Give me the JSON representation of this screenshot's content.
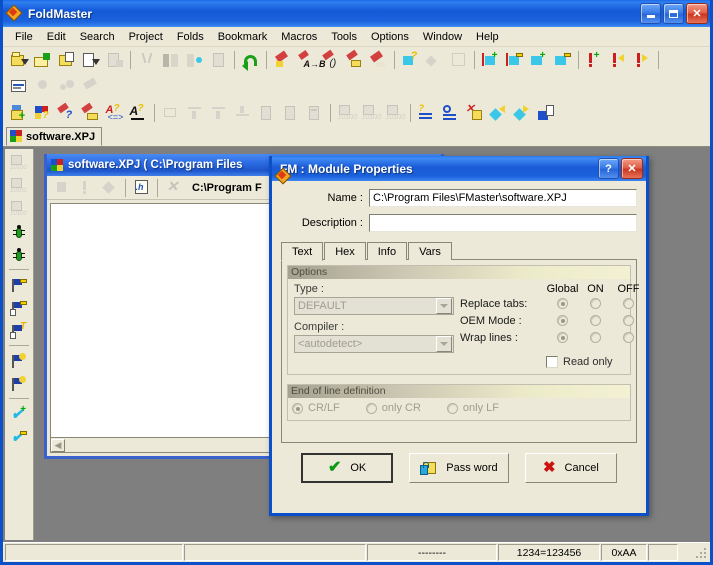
{
  "app": {
    "title": "FoldMaster",
    "icon": "diamond-icon",
    "caption_buttons": {
      "minimize": "minimize-button",
      "maximize": "maximize-button",
      "close": "close-button"
    }
  },
  "menubar": {
    "items": [
      "File",
      "Edit",
      "Search",
      "Project",
      "Folds",
      "Bookmark",
      "Macros",
      "Tools",
      "Options",
      "Window",
      "Help"
    ]
  },
  "project_tabs": [
    {
      "label": "software.XPJ",
      "icon": "project-icon",
      "active": true
    }
  ],
  "mdi_child": {
    "title": "software.XPJ ( C:\\Program Files",
    "path": "C:\\Program F",
    "toolbar": [
      "lock-icon",
      "exclamation-icon",
      "diamond-small-icon",
      "header-file-icon",
      "close-x-icon"
    ]
  },
  "dialog": {
    "title": "FM : Module Properties",
    "icon": "diamond-icon",
    "help_button": "?",
    "close_button": "✕",
    "fields": [
      {
        "label": "Name :",
        "value": "C:\\Program Files\\FMaster\\software.XPJ",
        "placeholder": ""
      },
      {
        "label": "Description :",
        "value": "",
        "placeholder": ""
      }
    ],
    "tabs": [
      {
        "label": "Text",
        "active": true
      },
      {
        "label": "Hex",
        "active": false
      },
      {
        "label": "Info",
        "active": false
      },
      {
        "label": "Vars",
        "active": false
      }
    ],
    "options_group": {
      "title": "Options",
      "type_label": "Type :",
      "type_value": "DEFAULT",
      "compiler_label": "Compiler :",
      "compiler_value": "<autodetect>",
      "columns": [
        "Global",
        "ON",
        "OFF"
      ],
      "rows": [
        {
          "label": "Replace tabs:",
          "selected": "Global"
        },
        {
          "label": "OEM Mode :",
          "selected": "Global"
        },
        {
          "label": "Wrap lines :",
          "selected": "Global"
        }
      ],
      "readonly_label": "Read only",
      "readonly_checked": false
    },
    "eol_group": {
      "title": "End of line definition",
      "options": [
        {
          "label": "CR/LF",
          "selected": true
        },
        {
          "label": "only CR",
          "selected": false
        },
        {
          "label": "only LF",
          "selected": false
        }
      ]
    },
    "buttons": [
      {
        "label": "OK",
        "icon": "check-icon",
        "default": true
      },
      {
        "label": "Pass word",
        "icon": "password-folder-icon",
        "default": false
      },
      {
        "label": "Cancel",
        "icon": "x-icon",
        "default": false
      }
    ]
  },
  "statusbar": {
    "panels": [
      "",
      "",
      "--------",
      "1234=123456",
      "0xAA",
      ""
    ]
  },
  "colors": {
    "titlebar_blue": "#1b62dd",
    "face": "#ece9d8",
    "mdi_background": "#7f7f7f",
    "dialog_border": "#0b50c8",
    "group_gradient_end": "#f2f1d2"
  }
}
